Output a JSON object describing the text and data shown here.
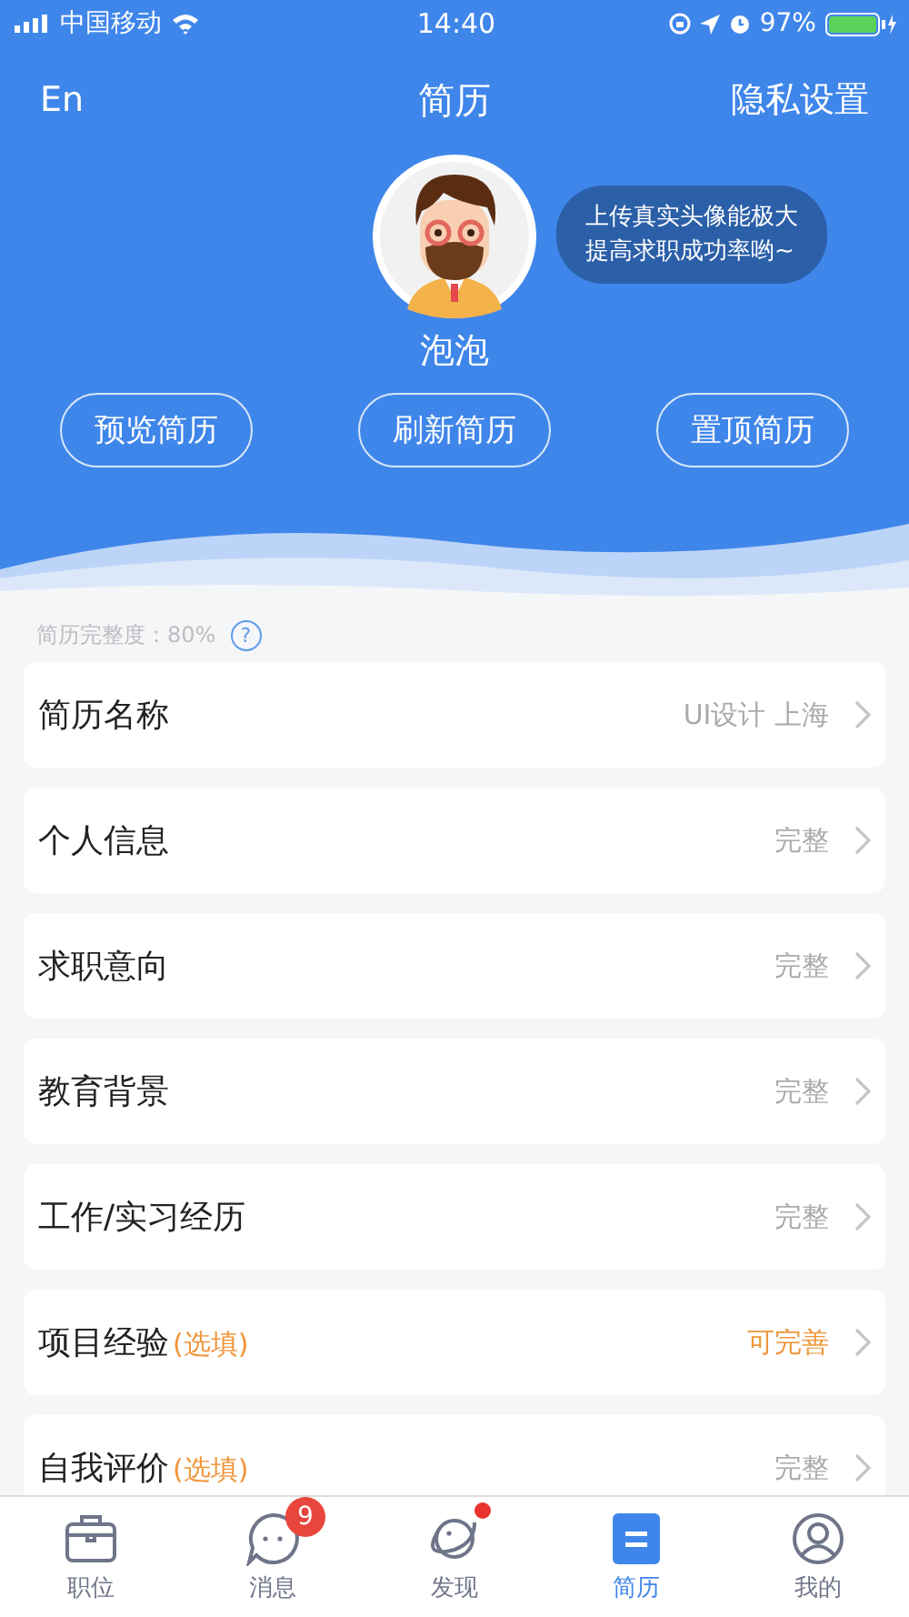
{
  "status_bar": {
    "carrier": "中国移动",
    "time": "14:40",
    "battery": "97%"
  },
  "nav": {
    "left": "En",
    "title": "简历",
    "right": "隐私设置"
  },
  "profile": {
    "name": "泡泡",
    "tip_lines": [
      "上传真实头像能极大",
      "提高求职成功率哟~"
    ]
  },
  "actions": [
    "预览简历",
    "刷新简历",
    "置顶简历"
  ],
  "completeness": {
    "label": "简历完整度：80%",
    "help": "?"
  },
  "sections": [
    {
      "title": "简历名称",
      "status": "UI设计 上海",
      "highlighted": false
    },
    {
      "title": "个人信息",
      "status": "完整",
      "highlighted": false
    },
    {
      "title": "求职意向",
      "status": "完整",
      "highlighted": false
    },
    {
      "title": "教育背景",
      "status": "完整",
      "highlighted": false
    },
    {
      "title": "工作/实习经历",
      "status": "完整",
      "highlighted": false
    },
    {
      "title": "项目经验",
      "optional_tag": "(选填)",
      "status": "可完善",
      "highlighted": true
    },
    {
      "title": "自我评价",
      "optional_tag": "(选填)",
      "status": "完整",
      "highlighted": false
    }
  ],
  "tabs": [
    {
      "label": "职位",
      "selected": false,
      "dot": false
    },
    {
      "label": "消息",
      "selected": false,
      "badge": "9",
      "dot": false
    },
    {
      "label": "发现",
      "selected": false,
      "dot": true
    },
    {
      "label": "简历",
      "selected": true,
      "dot": false
    },
    {
      "label": "我的",
      "selected": false,
      "dot": false
    }
  ]
}
